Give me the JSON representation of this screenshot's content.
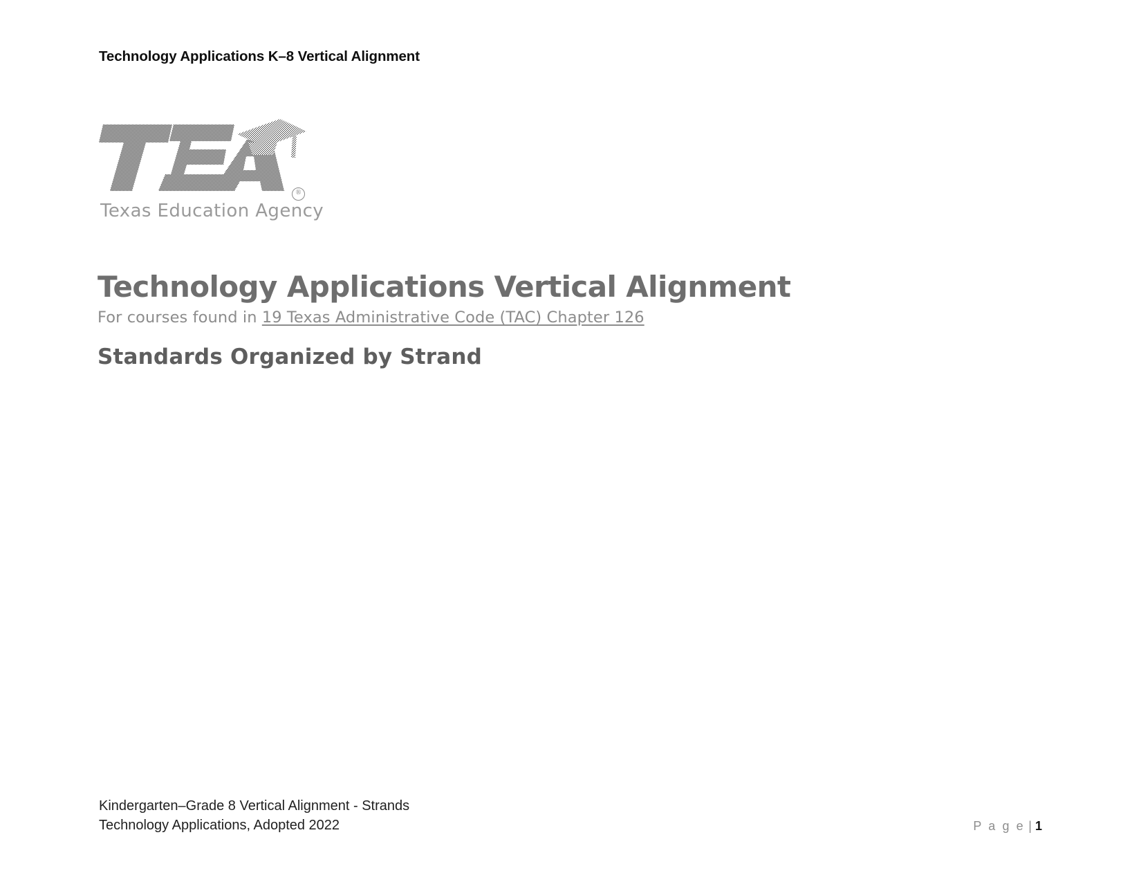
{
  "document": {
    "running_header": "Technology Applications K–8 Vertical Alignment",
    "page_background": "#ffffff"
  },
  "logo": {
    "mark_text": "TEA",
    "registered_mark": "®",
    "wordmark": "Texas Education Agency",
    "mark_color": "#6b6b6b",
    "wordmark_color": "#9a9a9a",
    "icon_name": "graduation-cap-icon"
  },
  "title_block": {
    "title": "Technology Applications Vertical Alignment",
    "subtitle_prefix": "For courses found in ",
    "subtitle_link": "19 Texas Administrative Code (TAC) Chapter 126",
    "heading2": "Standards Organized by Strand",
    "title_color": "#6e6e6e",
    "subtitle_color": "#8c8c8c"
  },
  "footer": {
    "line1": "Kindergarten–Grade 8 Vertical Alignment - Strands",
    "line2": "Technology Applications, Adopted 2022",
    "page_label": "P a g e",
    "page_separator": " | ",
    "page_number": "1"
  }
}
